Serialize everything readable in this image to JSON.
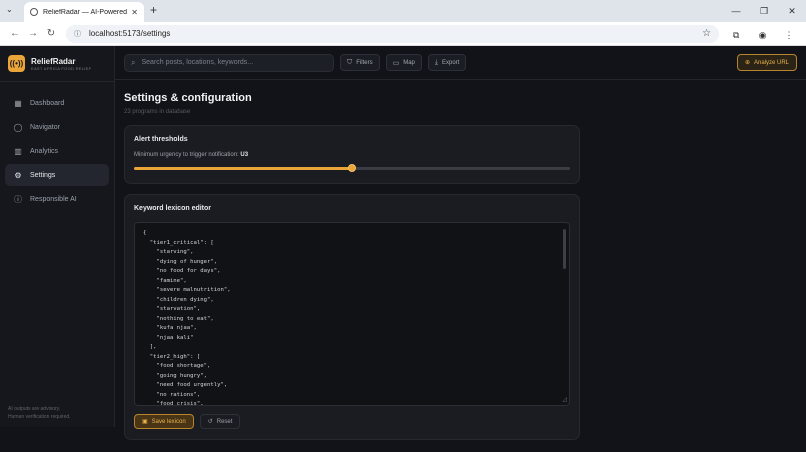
{
  "browser": {
    "tab_title": "ReliefRadar — AI-Powered Foo",
    "url": "localhost:5173/settings"
  },
  "sidebar": {
    "brand_name": "ReliefRadar",
    "brand_sub": "EAST AFRICA FOOD RELIEF",
    "items": [
      {
        "label": "Dashboard",
        "icon": "grid-icon"
      },
      {
        "label": "Navigator",
        "icon": "chat-icon"
      },
      {
        "label": "Analytics",
        "icon": "chart-icon"
      },
      {
        "label": "Settings",
        "icon": "gear-icon",
        "active": true
      },
      {
        "label": "Responsible AI",
        "icon": "info-icon"
      }
    ],
    "footer_line1": "AI outputs are advisory.",
    "footer_line2": "Human verification required."
  },
  "topbar": {
    "search_placeholder": "Search posts, locations, keywords...",
    "filters_label": "Filters",
    "map_label": "Map",
    "export_label": "Export",
    "analyze_label": "Analyze URL"
  },
  "page": {
    "title": "Settings & configuration",
    "subtitle": "23 programs in database"
  },
  "alert_card": {
    "title": "Alert thresholds",
    "label": "Minimum urgency to trigger notification:",
    "value": "U3",
    "slider_fraction": 0.5
  },
  "lexicon_card": {
    "title": "Keyword lexicon editor",
    "lines": [
      "{",
      "  \"tier1_critical\": [",
      "    \"starving\",",
      "    \"dying of hunger\",",
      "    \"no food for days\",",
      "    \"famine\",",
      "    \"severe malnutrition\",",
      "    \"children dying\",",
      "    \"starvation\",",
      "    \"nothing to eat\",",
      "    \"kufa njaa\",",
      "    \"njaa kali\"",
      "  ],",
      "  \"tier2_high\": [",
      "    \"food shortage\",",
      "    \"going hungry\",",
      "    \"need food urgently\",",
      "    \"no rations\",",
      "    \"food crisis\","
    ],
    "save_label": "Save lexicon",
    "reset_label": "Reset"
  }
}
